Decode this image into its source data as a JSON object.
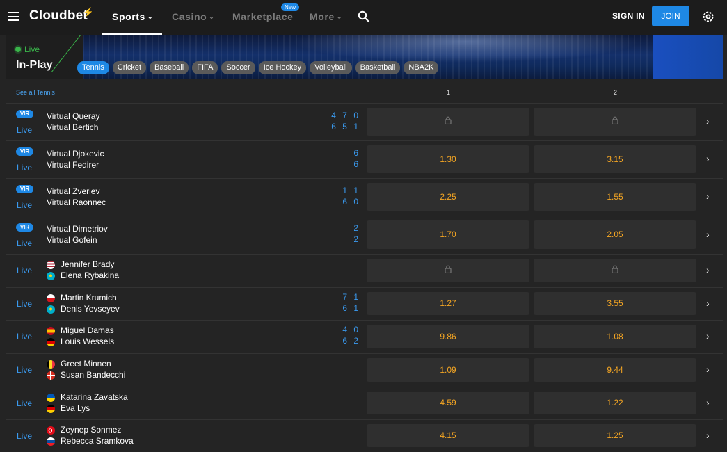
{
  "header": {
    "logo": "Cloudbet",
    "nav": [
      {
        "label": "Sports",
        "chev": "⌄"
      },
      {
        "label": "Casino",
        "chev": "⌄"
      },
      {
        "label": "Marketplace",
        "chev": ""
      },
      {
        "label": "More",
        "chev": "⌄"
      }
    ],
    "new_badge": "New",
    "sign_in": "SIGN IN",
    "join": "JOIN"
  },
  "inplay": {
    "live": "Live",
    "title": "In-Play",
    "sports": [
      "Tennis",
      "Cricket",
      "Baseball",
      "FIFA",
      "Soccer",
      "Ice Hockey",
      "Volleyball",
      "Basketball",
      "NBA2K"
    ],
    "active_sport": "Tennis"
  },
  "table": {
    "see_all": "See all Tennis",
    "col1": "1",
    "col2": "2",
    "vir_label": "VIR",
    "live_label": "Live",
    "arrow": "›",
    "rows": [
      {
        "vir": true,
        "p1": "Virtual Queray",
        "p2": "Virtual Bertich",
        "s1": "4 7 0",
        "s2": "6 5 1",
        "o1": "",
        "o2": "",
        "locked": true
      },
      {
        "vir": true,
        "p1": "Virtual Djokevic",
        "p2": "Virtual Fedirer",
        "s1": "6",
        "s2": "6",
        "o1": "1.30",
        "o2": "3.15",
        "locked": false
      },
      {
        "vir": true,
        "p1": "Virtual Zveriev",
        "p2": "Virtual Raonnec",
        "s1": "1 1",
        "s2": "6 0",
        "o1": "2.25",
        "o2": "1.55",
        "locked": false
      },
      {
        "vir": true,
        "p1": "Virtual Dimetriov",
        "p2": "Virtual Gofein",
        "s1": "2",
        "s2": "2",
        "o1": "1.70",
        "o2": "2.05",
        "locked": false
      },
      {
        "vir": false,
        "p1": "Jennifer Brady",
        "p2": "Elena Rybakina",
        "f1": "us",
        "f2": "kz",
        "s1": "",
        "s2": "",
        "o1": "",
        "o2": "",
        "locked": true
      },
      {
        "vir": false,
        "p1": "Martin Krumich",
        "p2": "Denis Yevseyev",
        "f1": "cz",
        "f2": "kz",
        "s1": "7 1",
        "s2": "6 1",
        "o1": "1.27",
        "o2": "3.55",
        "locked": false
      },
      {
        "vir": false,
        "p1": "Miguel Damas",
        "p2": "Louis Wessels",
        "f1": "es",
        "f2": "de",
        "s1": "4 0",
        "s2": "6 2",
        "o1": "9.86",
        "o2": "1.08",
        "locked": false
      },
      {
        "vir": false,
        "p1": "Greet Minnen",
        "p2": "Susan Bandecchi",
        "f1": "be",
        "f2": "ch",
        "s1": "",
        "s2": "",
        "o1": "1.09",
        "o2": "9.44",
        "locked": false
      },
      {
        "vir": false,
        "p1": "Katarina Zavatska",
        "p2": "Eva Lys",
        "f1": "ua",
        "f2": "de",
        "s1": "",
        "s2": "",
        "o1": "4.59",
        "o2": "1.22",
        "locked": false
      },
      {
        "vir": false,
        "p1": "Zeynep Sonmez",
        "p2": "Rebecca Sramkova",
        "f1": "tr",
        "f2": "sk",
        "s1": "",
        "s2": "",
        "o1": "4.15",
        "o2": "1.25",
        "locked": false
      }
    ]
  },
  "colors": {
    "accent": "#1e88e5",
    "live": "#39b54a",
    "odds": "#f5a623",
    "link": "#3a9aef"
  }
}
